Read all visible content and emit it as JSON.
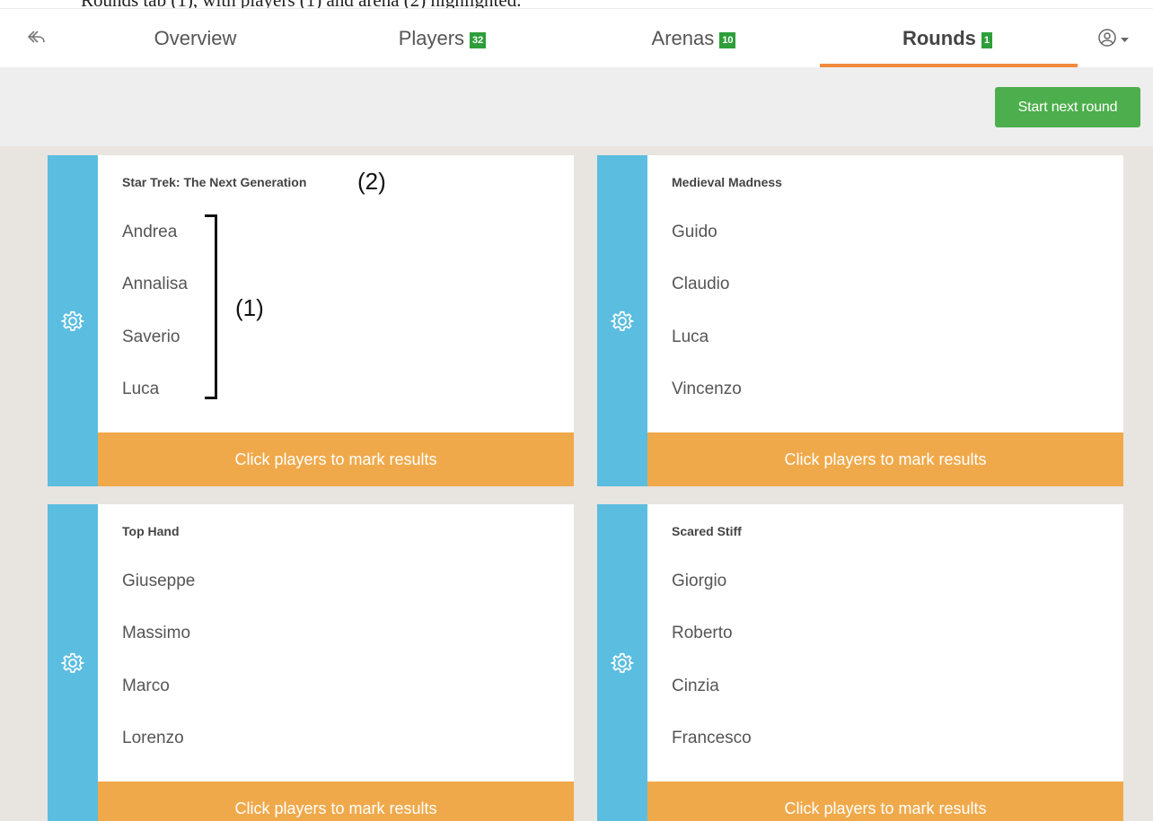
{
  "caption": "Rounds tab (1), with players (1) and arena (2) highlighted.",
  "nav": {
    "back_icon": "reply-icon",
    "tabs": [
      {
        "label": "Overview",
        "badge": ""
      },
      {
        "label": "Players",
        "badge": "32"
      },
      {
        "label": "Arenas",
        "badge": "10"
      },
      {
        "label": "Rounds",
        "badge": "1"
      }
    ],
    "active_tab": "Rounds",
    "user_icon": "user-circle-icon",
    "accent": "#f08a3c",
    "badge_color": "#2e9e3a"
  },
  "toolbar": {
    "start_label": "Start next round",
    "start_color": "#4cae4c"
  },
  "cards": [
    {
      "arena": "Star Trek: The Next Generation",
      "players": [
        "Andrea",
        "Annalisa",
        "Saverio",
        "Luca"
      ],
      "results_label": "Click players to mark results",
      "settings_icon": "gear-icon"
    },
    {
      "arena": "Medieval Madness",
      "players": [
        "Guido",
        "Claudio",
        "Luca",
        "Vincenzo"
      ],
      "results_label": "Click players to mark results",
      "settings_icon": "gear-icon"
    },
    {
      "arena": "Top Hand",
      "players": [
        "Giuseppe",
        "Massimo",
        "Marco",
        "Lorenzo"
      ],
      "results_label": "Click players to mark results",
      "settings_icon": "gear-icon"
    },
    {
      "arena": "Scared Stiff",
      "players": [
        "Giorgio",
        "Roberto",
        "Cinzia",
        "Francesco"
      ],
      "results_label": "Click players to mark results",
      "settings_icon": "gear-icon"
    }
  ],
  "colors": {
    "card_side": "#5bbde0",
    "results_bar": "#f0a94a"
  },
  "annotations": {
    "players_marker": "(1)",
    "arena_marker": "(2)"
  }
}
